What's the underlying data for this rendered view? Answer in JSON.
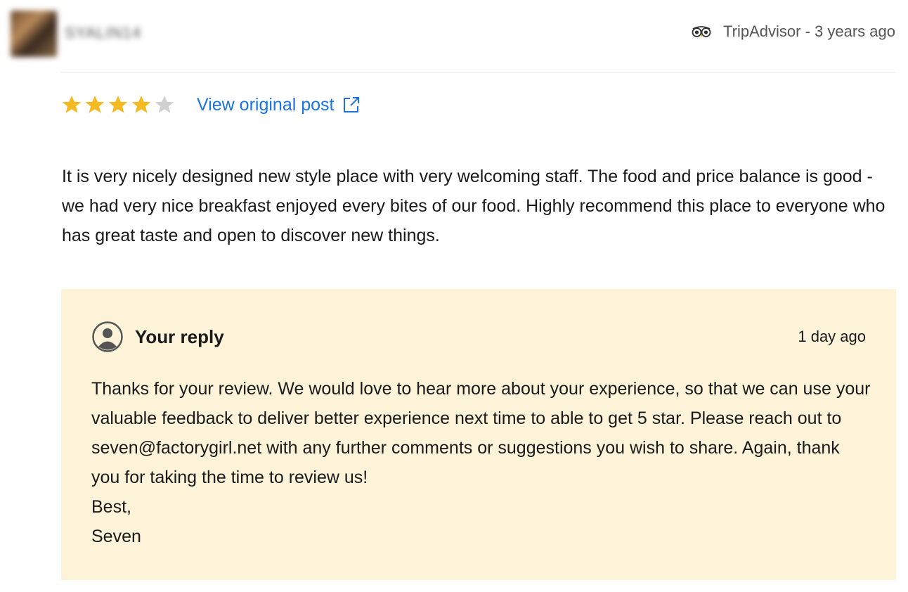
{
  "reviewer": {
    "name": "SYALIN14",
    "avatar_icon": "reviewer-avatar"
  },
  "source": {
    "icon": "tripadvisor-owl-icon",
    "label": "TripAdvisor - 3 years ago"
  },
  "rating": {
    "value": 4,
    "max": 5,
    "filled_color": "#f5b921",
    "empty_color": "#d0d0d0"
  },
  "view_link": {
    "label": "View original post",
    "icon": "external-link-icon",
    "color": "#1a73e8"
  },
  "review": {
    "text": "It is very nicely designed new style place with very welcoming staff. The food and price balance is good - we had very nice breakfast enjoyed every bites of our food. Highly recommend this place to everyone who has great taste and open to discover new things."
  },
  "reply": {
    "title": "Your reply",
    "time": "1 day ago",
    "icon": "user-circle-icon",
    "background": "#fcf3d9",
    "body": "Thanks for your review. We would love to hear more about your experience, so that we can use your valuable feedback to deliver better experience next time to able to get 5 star. Please reach out to seven@factorygirl.net with any further comments or suggestions you wish to share. Again, thank you for taking the time to review us!",
    "signoff": "Best,",
    "signature": "Seven"
  }
}
